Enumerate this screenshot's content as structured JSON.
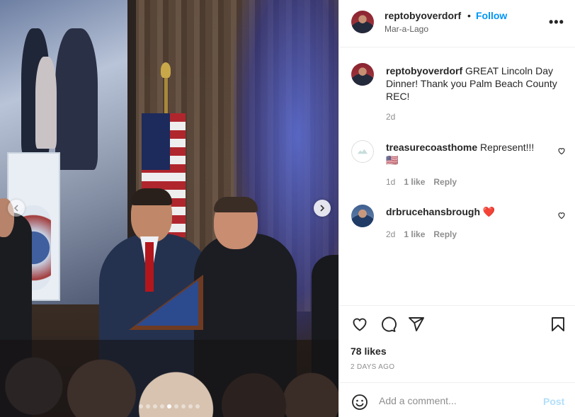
{
  "post": {
    "username": "reptobyoverdorf",
    "separator": "•",
    "follow_label": "Follow",
    "location": "Mar-a-Lago",
    "more_icon": "more-horizontal-icon",
    "more_label": "•••"
  },
  "caption": {
    "username": "reptobyoverdorf",
    "text": " GREAT Lincoln Day Dinner! Thank you Palm Beach County REC!",
    "time": "2d"
  },
  "comments": [
    {
      "username": "treasurecoasthome",
      "text": " Represent!!!",
      "emoji": "🇺🇸",
      "time": "1d",
      "likes": "1 like",
      "reply": "Reply"
    },
    {
      "username": "drbrucehansbrough",
      "text": " ",
      "emoji": "❤️",
      "time": "2d",
      "likes": "1 like",
      "reply": "Reply"
    }
  ],
  "carousel": {
    "total": 9,
    "active": 5
  },
  "actions": {
    "icons": [
      "heart-icon",
      "comment-icon",
      "share-icon",
      "bookmark-icon"
    ]
  },
  "likes": "78 likes",
  "posted_ago": "2 DAYS AGO",
  "comment_box": {
    "placeholder": "Add a comment...",
    "post_label": "Post"
  },
  "colors": {
    "accent": "#0095f6",
    "post_disabled": "#b2dffc",
    "text": "#262626",
    "muted": "#8e8e8e"
  }
}
